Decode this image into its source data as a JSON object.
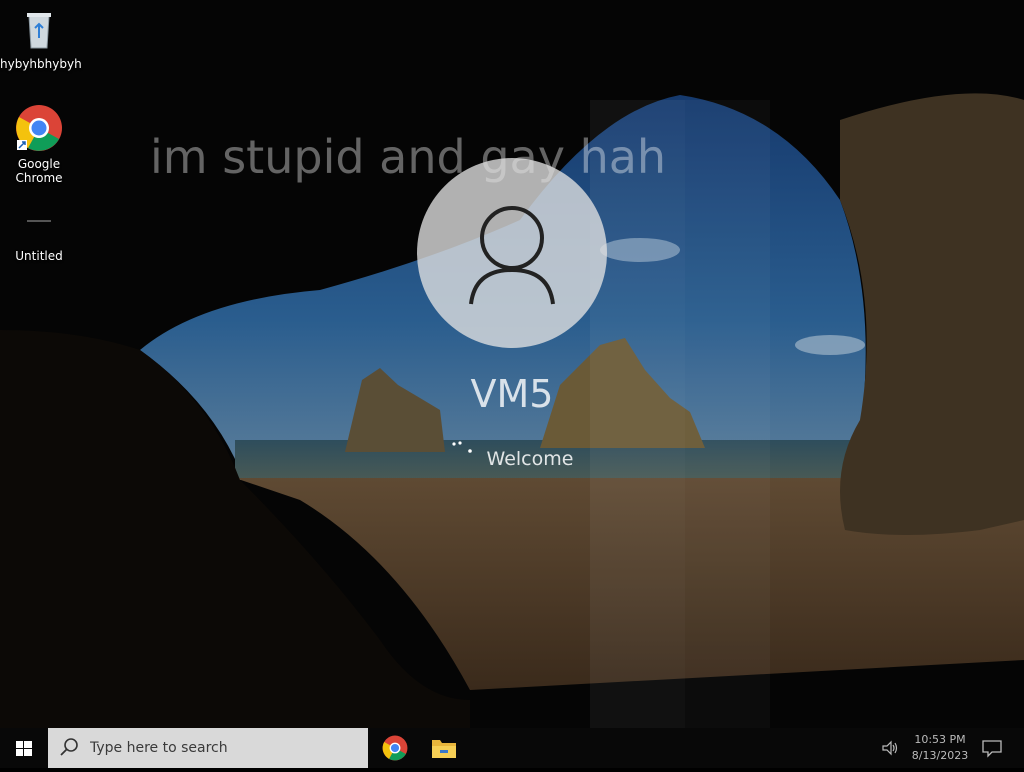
{
  "desktop": {
    "icons": [
      {
        "label": "hybyhbhybyh",
        "icon": "recycle-bin-icon"
      },
      {
        "label": "Google Chrome",
        "icon": "chrome-icon"
      },
      {
        "label": "Untitled",
        "icon": "blank-file-icon"
      }
    ]
  },
  "overlay": {
    "text": "im stupid and gay hah"
  },
  "login": {
    "username": "VM5",
    "status": "Welcome"
  },
  "taskbar": {
    "search_placeholder": "Type here to search",
    "pinned": [
      {
        "name": "chrome-icon"
      },
      {
        "name": "file-explorer-icon"
      }
    ],
    "clock": {
      "time": "10:53 PM",
      "date": "8/13/2023"
    }
  }
}
